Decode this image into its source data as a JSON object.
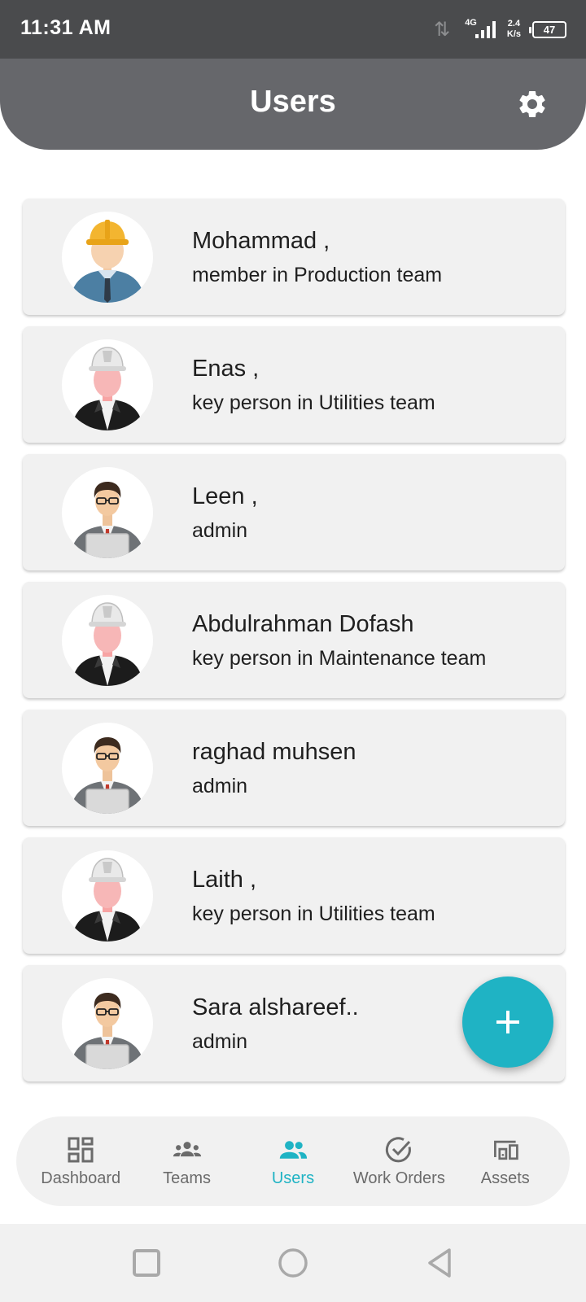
{
  "status_bar": {
    "time": "11:31 AM",
    "network_type": "4G",
    "speed_value": "2.4",
    "speed_unit": "K/s",
    "battery": "47"
  },
  "header": {
    "title": "Users",
    "settings_icon": "gear-icon"
  },
  "users": [
    {
      "name": "Mohammad ,",
      "role": "member in Production team",
      "avatar": "worker"
    },
    {
      "name": "Enas ,",
      "role": "key person in Utilities team",
      "avatar": "engineer"
    },
    {
      "name": "Leen ,",
      "role": "admin",
      "avatar": "admin"
    },
    {
      "name": "Abdulrahman Dofash",
      "role": "key person in Maintenance team",
      "avatar": "engineer"
    },
    {
      "name": "raghad muhsen",
      "role": "admin",
      "avatar": "admin"
    },
    {
      "name": "Laith ,",
      "role": "key person in Utilities team",
      "avatar": "engineer"
    },
    {
      "name": "Sara alshareef..",
      "role": "admin",
      "avatar": "admin"
    }
  ],
  "fab": {
    "icon": "plus-icon"
  },
  "bottom_nav": {
    "items": [
      {
        "label": "Dashboard",
        "icon": "dashboard-icon",
        "active": false
      },
      {
        "label": "Teams",
        "icon": "teams-icon",
        "active": false
      },
      {
        "label": "Users",
        "icon": "users-icon",
        "active": true
      },
      {
        "label": "Work Orders",
        "icon": "check-circle-icon",
        "active": false
      },
      {
        "label": "Assets",
        "icon": "devices-icon",
        "active": false
      }
    ]
  },
  "colors": {
    "accent": "#1fb3c4",
    "header": "#66676b",
    "status_bar": "#4a4b4d",
    "card": "#f1f1f1"
  }
}
